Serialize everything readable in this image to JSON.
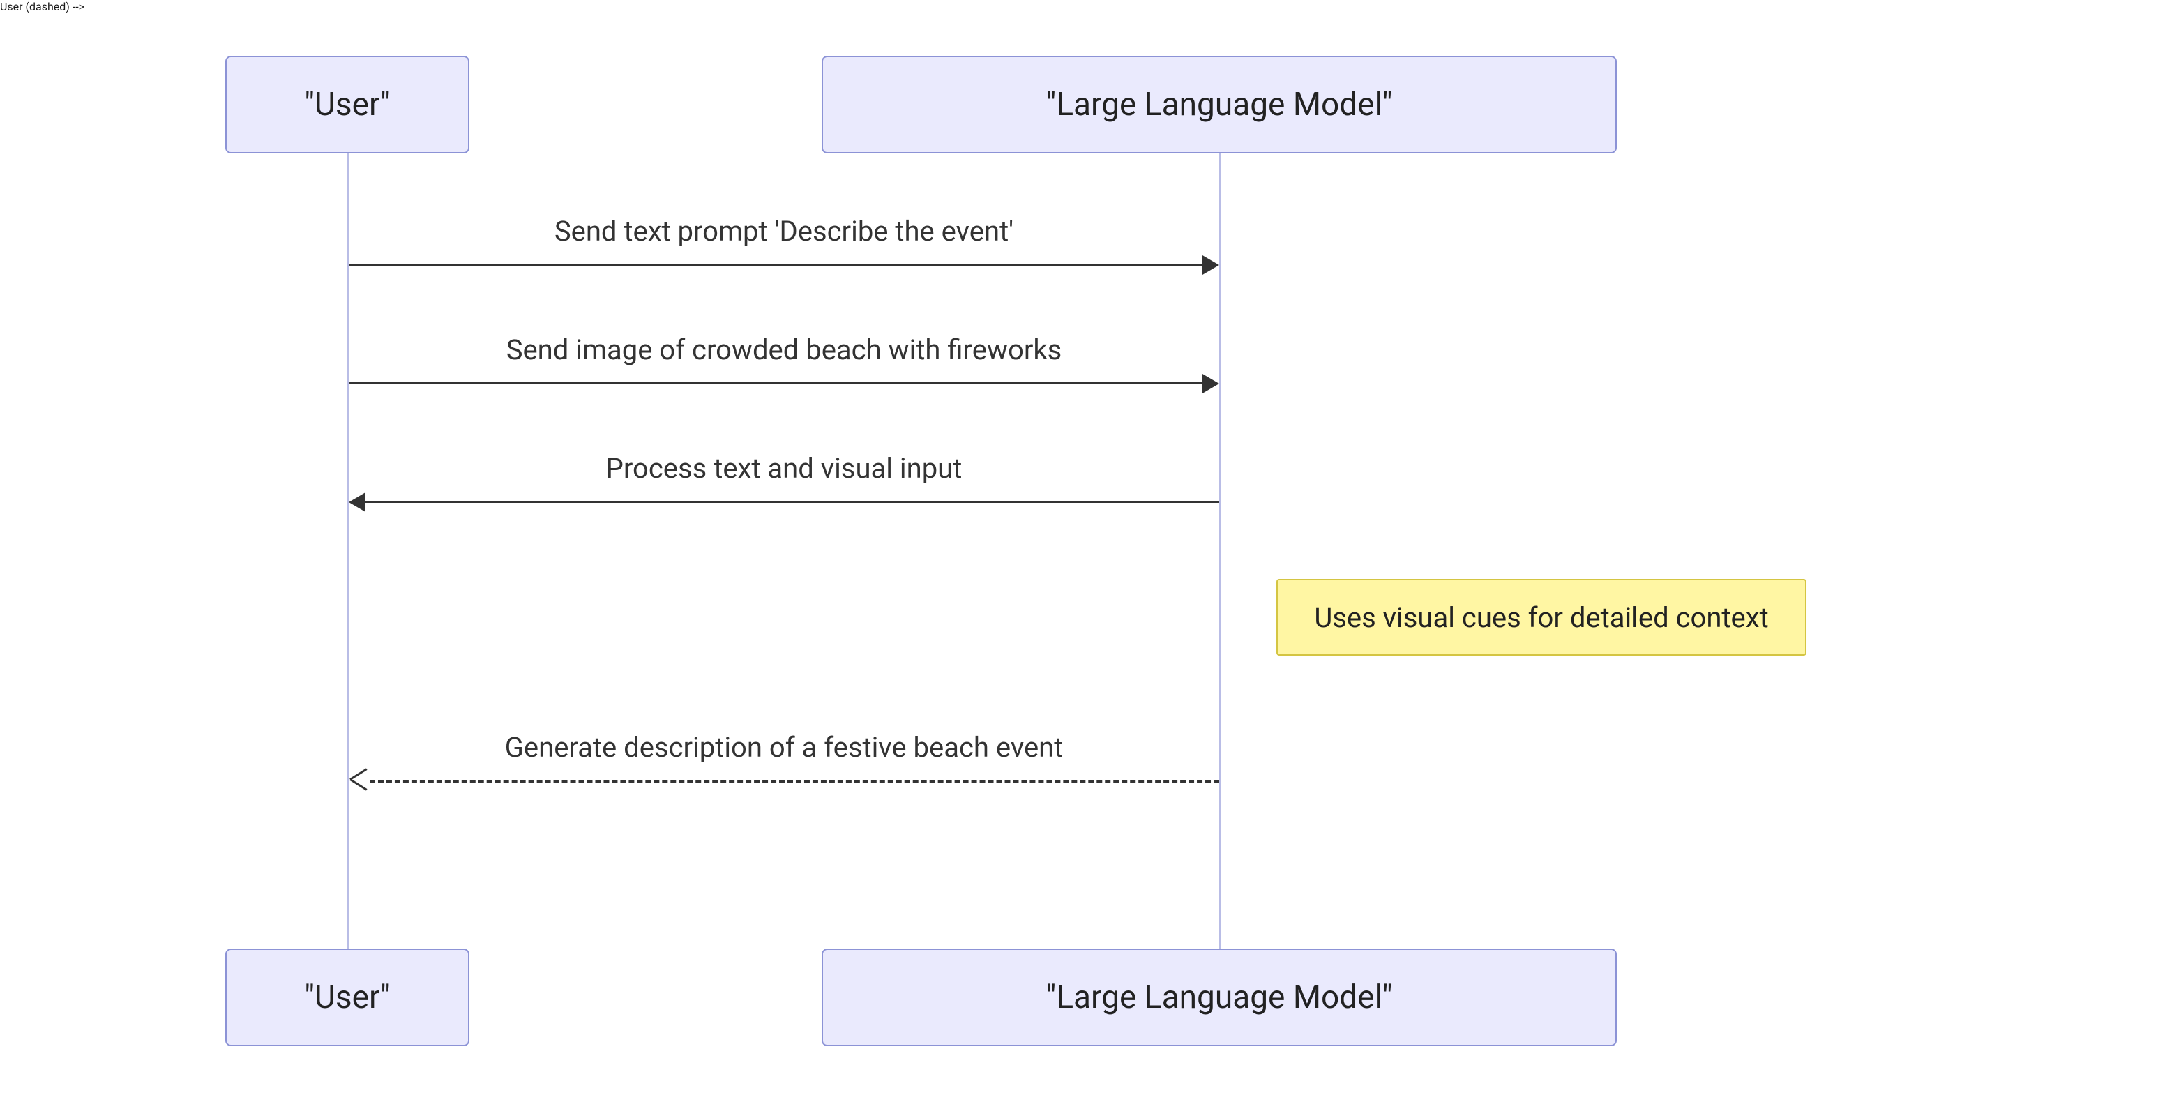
{
  "actors": {
    "user_label": "\"User\"",
    "llm_label": "\"Large Language Model\""
  },
  "messages": {
    "m1": "Send text prompt 'Describe the event'",
    "m2": "Send image of crowded beach with fireworks",
    "m3": "Process text and visual input",
    "m4": "Generate description of a festive beach event"
  },
  "note": {
    "text": "Uses visual cues for detailed context"
  },
  "chart_data": {
    "type": "sequence-diagram",
    "participants": [
      "User",
      "Large Language Model"
    ],
    "interactions": [
      {
        "from": "User",
        "to": "Large Language Model",
        "label": "Send text prompt 'Describe the event'",
        "style": "solid"
      },
      {
        "from": "User",
        "to": "Large Language Model",
        "label": "Send image of crowded beach with fireworks",
        "style": "solid"
      },
      {
        "from": "Large Language Model",
        "to": "User",
        "label": "Process text and visual input",
        "style": "solid"
      },
      {
        "note_right_of": "Large Language Model",
        "text": "Uses visual cues for detailed context"
      },
      {
        "from": "Large Language Model",
        "to": "User",
        "label": "Generate description of a festive beach event",
        "style": "dashed"
      }
    ]
  }
}
